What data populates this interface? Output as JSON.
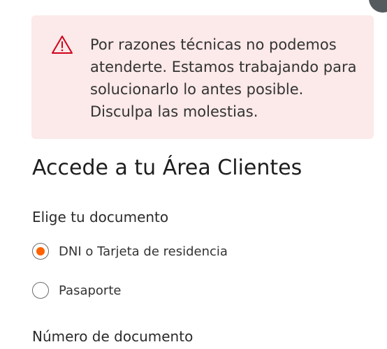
{
  "colors": {
    "alert_background": "#fce9e9",
    "alert_icon": "#d0021b",
    "radio_selected": "#ff6200",
    "text": "#333333"
  },
  "alert": {
    "icon": "warning-triangle-icon",
    "message": "Por razones técnicas no podemos atenderte. Estamos trabajando para solucionarlo lo antes posible. Disculpa las molestias."
  },
  "page": {
    "title": "Accede a tu Área Clientes"
  },
  "document_type": {
    "label": "Elige tu documento",
    "selected": "dni",
    "options": [
      {
        "id": "dni",
        "label": "DNI o Tarjeta de residencia"
      },
      {
        "id": "pasaporte",
        "label": "Pasaporte"
      }
    ]
  },
  "document_number": {
    "label": "Número de documento"
  }
}
